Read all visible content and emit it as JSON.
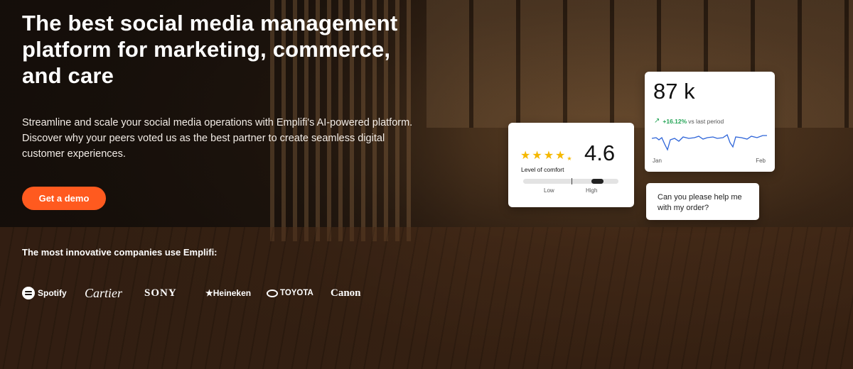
{
  "hero": {
    "title": "The best social media management platform for marketing, commerce, and care",
    "subtitle": "Streamline and scale your social media operations with Emplifi's AI-powered platform. Discover why your peers voted us as the best partner to create seamless digital customer experiences.",
    "cta_label": "Get a demo",
    "companies_heading": "The most innovative companies use Emplifi:"
  },
  "logos": {
    "spotify": "Spotify",
    "cartier": "Cartier",
    "sony": "SONY",
    "heineken": "★Heineken",
    "toyota": "TOYOTA",
    "canon": "Canon"
  },
  "rating_card": {
    "value": "4.6",
    "stars": 4.5,
    "label": "Level of comfort",
    "low_label": "Low",
    "high_label": "High",
    "comfort_level": 0.78
  },
  "stats_card": {
    "value": "87 k",
    "change": "+16.12%",
    "change_suffix": "vs last period",
    "start_label": "Jan",
    "end_label": "Feb"
  },
  "chat_card": {
    "message": "Can you please help me with my order?"
  },
  "colors": {
    "accent": "#ff5a1f",
    "positive": "#23a455",
    "star": "#f5b800",
    "line": "#2c63d8"
  }
}
